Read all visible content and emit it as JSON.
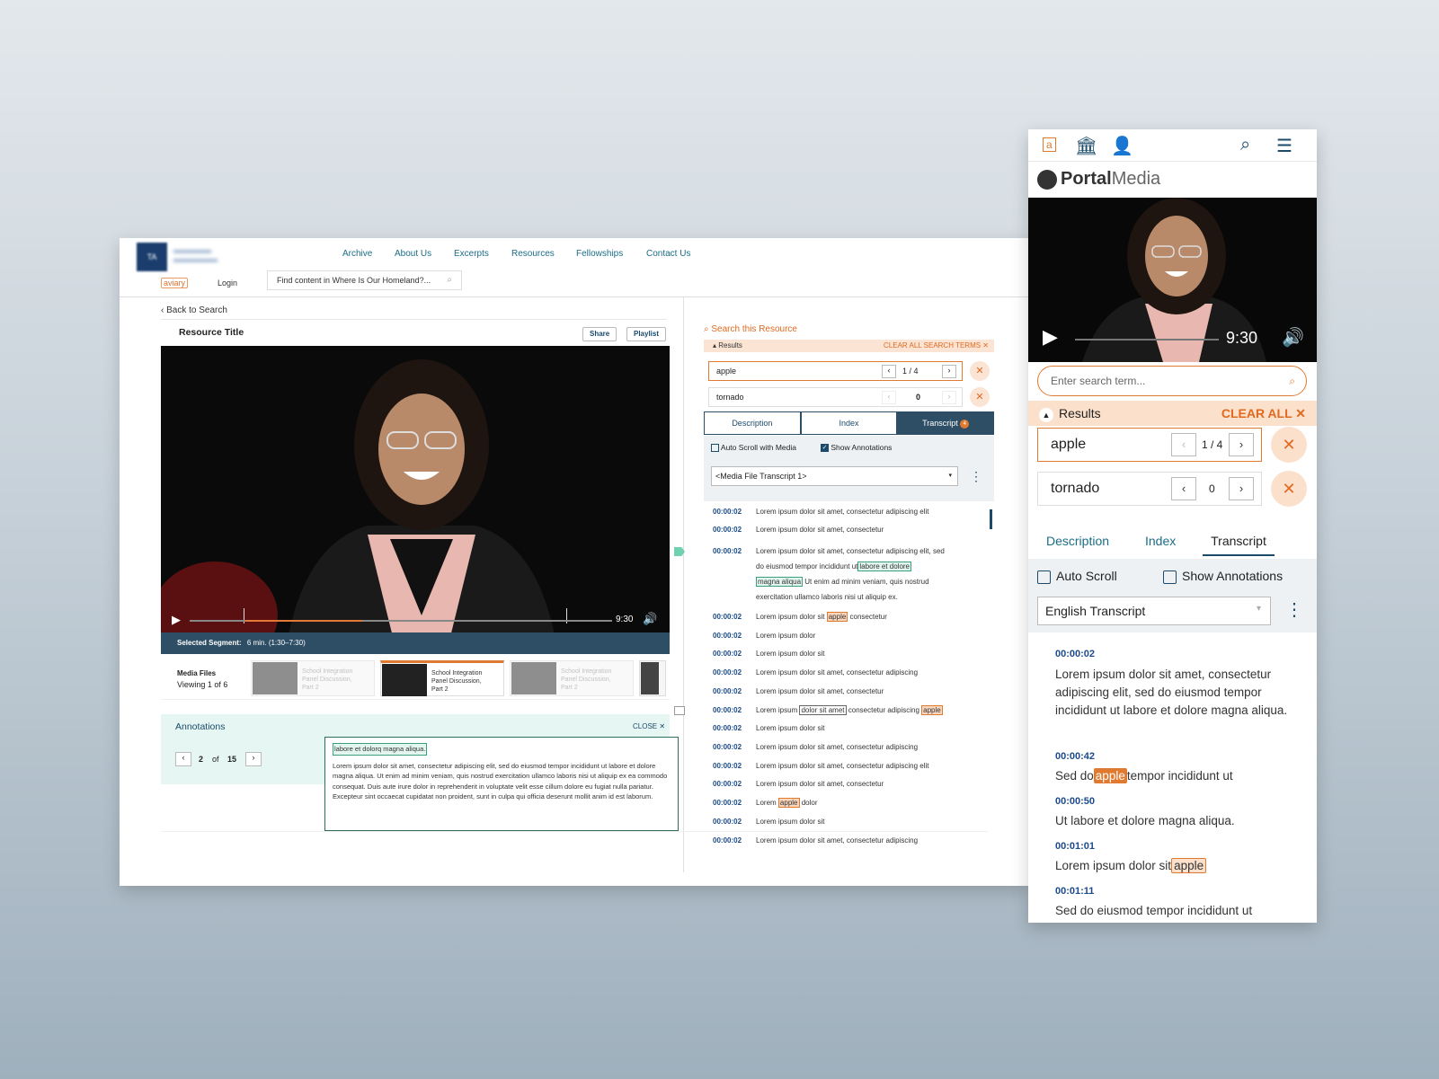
{
  "desktop": {
    "nav": [
      "Archive",
      "About Us",
      "Excerpts",
      "Resources",
      "Fellowships",
      "Contact Us"
    ],
    "logo_text": "TA",
    "aviary": "aviary",
    "login": "Login",
    "search_placeholder": "Find content in Where Is Our Homeland?...",
    "back": "‹ Back to Search",
    "resource_title": "Resource Title",
    "share": "Share",
    "playlist": "Playlist",
    "time": "9:30",
    "selected_segment_label": "Selected Segment:",
    "selected_segment_value": "6 min. (1:30–7:30)",
    "media_files_label": "Media Files",
    "media_files_count": "Viewing 1 of 6",
    "thumb_title": "School Integration Panel Discussion, Part 2",
    "annotations": "Annotations",
    "close": "CLOSE ✕",
    "page_current": "2",
    "page_of": "of",
    "page_total": "15",
    "annot_quote": "labore et dolorq magna aliqua.",
    "annot_body": "Lorem ipsum dolor sit amet, consectetur adipiscing elit, sed do eiusmod tempor incididunt ut labore et dolore magna aliqua. Ut enim ad minim veniam, quis nostrud exercitation ullamco laboris nisi ut aliquip ex ea commodo consequat. Duis aute irure dolor in reprehenderit in voluptate velit esse cillum dolore eu fugiat nulla pariatur. Excepteur sint occaecat cupidatat non proident, sunt in culpa qui officia deserunt mollit anim id est laborum.",
    "search_resource": "Search this Resource",
    "results": "Results",
    "clear_all": "CLEAR ALL SEARCH TERMS ✕",
    "terms": [
      {
        "term": "apple",
        "count": "1 / 4"
      },
      {
        "term": "tornado",
        "count": "0"
      }
    ],
    "tabs": [
      "Description",
      "Index",
      "Transcript"
    ],
    "transcript_badge": "4",
    "auto_scroll": "Auto Scroll with Media",
    "show_annotations": "Show Annotations",
    "transcript_select": "<Media File Transcript 1>",
    "transcript_rows": [
      {
        "ts": "00:00:02",
        "text": "Lorem ipsum dolor sit amet, consectetur adipiscing elit"
      },
      {
        "ts": "00:00:02",
        "text": "Lorem ipsum dolor sit amet, consectetur"
      },
      {
        "ts": "00:00:02",
        "text": "Lorem ipsum dolor sit amet, consectetur adipiscing elit, sed"
      },
      {
        "ts": "",
        "text": "do eiusmod tempor incididunt ut"
      },
      {
        "ts": "",
        "text": "labore et dolore"
      },
      {
        "ts": "",
        "text": "magna aliqua"
      },
      {
        "ts": "",
        "text": "Ut enim ad minim veniam, quis nostrud"
      },
      {
        "ts": "",
        "text": "exercitation ullamco laboris nisi ut aliquip ex."
      },
      {
        "ts": "00:00:02",
        "text": "Lorem ipsum dolor sit"
      },
      {
        "ts": "",
        "text": "apple"
      },
      {
        "ts": "",
        "text": "consectetur"
      },
      {
        "ts": "00:00:02",
        "text": "Lorem ipsum dolor"
      },
      {
        "ts": "00:00:02",
        "text": "Lorem ipsum dolor sit"
      },
      {
        "ts": "00:00:02",
        "text": "Lorem ipsum dolor sit amet, consectetur adipiscing"
      },
      {
        "ts": "00:00:02",
        "text": "Lorem ipsum dolor sit amet, consectetur"
      },
      {
        "ts": "00:00:02",
        "text": "Lorem ipsum"
      },
      {
        "ts": "",
        "text": "dolor sit amet"
      },
      {
        "ts": "",
        "text": "consectetur adipiscing"
      },
      {
        "ts": "",
        "text": "apple"
      },
      {
        "ts": "00:00:02",
        "text": "Lorem ipsum dolor sit"
      },
      {
        "ts": "00:00:02",
        "text": "Lorem ipsum dolor sit amet, consectetur adipiscing"
      },
      {
        "ts": "00:00:02",
        "text": "Lorem ipsum dolor sit amet, consectetur adipiscing elit"
      },
      {
        "ts": "00:00:02",
        "text": "Lorem ipsum dolor sit amet, consectetur"
      },
      {
        "ts": "00:00:02",
        "text": "Lorem"
      },
      {
        "ts": "",
        "text": "apple"
      },
      {
        "ts": "",
        "text": "dolor"
      },
      {
        "ts": "00:00:02",
        "text": "Lorem ipsum dolor sit"
      },
      {
        "ts": "00:00:02",
        "text": "Lorem ipsum dolor sit amet, consectetur adipiscing"
      }
    ]
  },
  "mobile": {
    "logo_a": "a",
    "brand_bold": "Portal",
    "brand_light": "Media",
    "time": "9:30",
    "search_placeholder": "Enter search term...",
    "results": "Results",
    "clear_all": "CLEAR ALL ✕",
    "terms": [
      {
        "term": "apple",
        "count": "1 / 4"
      },
      {
        "term": "tornado",
        "count": "0"
      }
    ],
    "tabs": [
      "Description",
      "Index",
      "Transcript"
    ],
    "auto_scroll": "Auto Scroll",
    "show_annotations": "Show Annotations",
    "transcript_select": "English Transcript",
    "entries": [
      {
        "ts": "00:00:02",
        "text": "Lorem ipsum dolor sit amet, consectetur adipiscing elit, sed do eiusmod tempor incididunt ut labore et dolore magna aliqua."
      },
      {
        "ts": "00:00:42",
        "pre": "Sed do",
        "hl": "apple",
        "post": "tempor incididunt ut"
      },
      {
        "ts": "00:00:50",
        "text": "Ut labore et dolore magna aliqua."
      },
      {
        "ts": "00:01:01",
        "pre": "Lorem ipsum dolor sit",
        "hl": "apple",
        "post": ""
      },
      {
        "ts": "00:01:11",
        "text": "Sed do eiusmod tempor incididunt ut"
      }
    ]
  },
  "colors": {
    "accent": "#e07a30",
    "navy": "#1b4a6b",
    "teal": "#1b6d86",
    "highlight_bg": "#fbe0cc"
  }
}
